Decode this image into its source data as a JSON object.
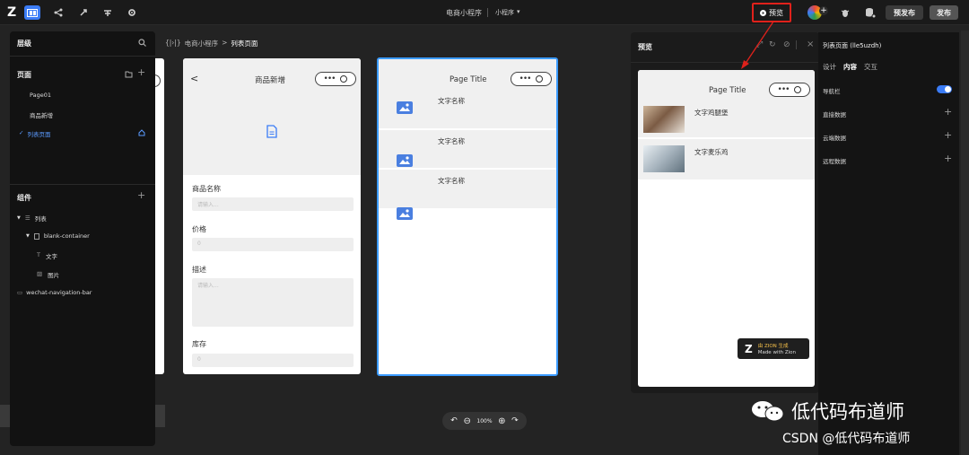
{
  "topbar": {
    "logo": "Z",
    "app_name": "电商小程序",
    "platform": "小程序",
    "preview_label": "预览",
    "prerelease_label": "预发布",
    "publish_label": "发布"
  },
  "layers": {
    "title": "层级",
    "pages_title": "页面",
    "pages": [
      "Page01",
      "商品新增",
      "列表页面"
    ],
    "components_title": "组件",
    "tree": [
      "列表",
      "blank-container",
      "文字",
      "图片",
      "wechat-navigation-bar"
    ]
  },
  "breadcrumb": {
    "icon_text": "{|›|}",
    "app": "电商小程序",
    "sep": ">",
    "page": "列表页面"
  },
  "form_page": {
    "title": "商品新增",
    "fields": [
      {
        "label": "商品名称",
        "placeholder": "请输入..."
      },
      {
        "label": "价格",
        "placeholder": "0"
      },
      {
        "label": "描述",
        "placeholder": "请输入..."
      },
      {
        "label": "库存",
        "placeholder": "0"
      }
    ]
  },
  "list_page": {
    "title": "Page Title",
    "items": [
      "文字名称",
      "文字名称",
      "文字名称"
    ]
  },
  "preview": {
    "title": "预览",
    "page_title": "Page Title",
    "items": [
      "文字鸡腿堡",
      "文字麦乐鸡"
    ],
    "badge_top": "由 ZION 生成",
    "badge_bottom": "Made with Zion"
  },
  "props": {
    "title": "列表页面 (lle5uzdh)",
    "tabs": [
      "设计",
      "内容",
      "交互"
    ],
    "active_tab": "内容",
    "rows": [
      "导航栏",
      "直接数据",
      "云端数据",
      "远程数据"
    ]
  },
  "zoom": {
    "value": "100%"
  },
  "watermark": {
    "wechat": "低代码布道师",
    "csdn": "CSDN @低代码布道师"
  },
  "colors": {
    "accent": "#3b7cf6",
    "highlight": "#e0211b"
  }
}
